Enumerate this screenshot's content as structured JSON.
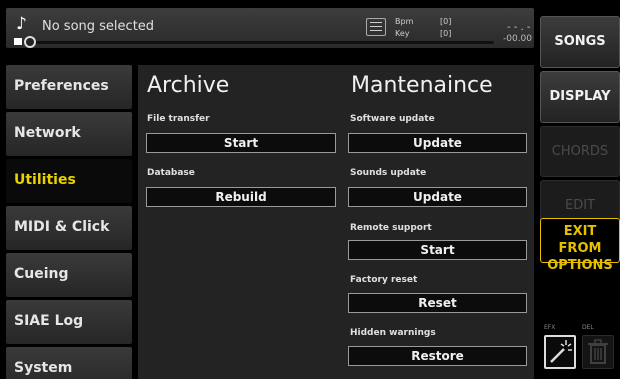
{
  "header": {
    "song_title": "No song selected",
    "bpm_label": "Bpm",
    "bpm_value": "[0]",
    "key_label": "Key",
    "key_value": "[0]",
    "time_dashes": "- - . -",
    "time_value": "-00.00"
  },
  "sidebar": {
    "items": [
      {
        "label": "Preferences"
      },
      {
        "label": "Network"
      },
      {
        "label": "Utilities"
      },
      {
        "label": "MIDI & Click"
      },
      {
        "label": "Cueing"
      },
      {
        "label": "SIAE Log"
      },
      {
        "label": "System"
      }
    ],
    "active_index": 2
  },
  "archive": {
    "title": "Archive",
    "file_transfer": {
      "label": "File transfer",
      "button": "Start"
    },
    "database": {
      "label": "Database",
      "button": "Rebuild"
    }
  },
  "maintenance": {
    "title": "Mantenaince",
    "software_update": {
      "label": "Software update",
      "button": "Update"
    },
    "sounds_update": {
      "label": "Sounds update",
      "button": "Update"
    },
    "remote_support": {
      "label": "Remote support",
      "button": "Start"
    },
    "factory_reset": {
      "label": "Factory reset",
      "button": "Reset"
    },
    "hidden_warnings": {
      "label": "Hidden warnings",
      "button": "Restore"
    }
  },
  "rail": {
    "songs": "SONGS",
    "display": "DISPLAY",
    "chords": "CHORDS",
    "edit": "EDIT",
    "exit_line1": "EXIT FROM",
    "exit_line2": "OPTIONS",
    "efx_label": "EFX",
    "del_label": "DEL"
  },
  "colors": {
    "accent_yellow": "#e6c000",
    "active_text": "#e8d200",
    "panel_bg": "#232323",
    "button_bg": "#0c0c0c"
  },
  "icons": {
    "music": "music-note-icon",
    "bpm": "list-icon",
    "efx": "magic-wand-icon",
    "del": "trash-icon"
  }
}
